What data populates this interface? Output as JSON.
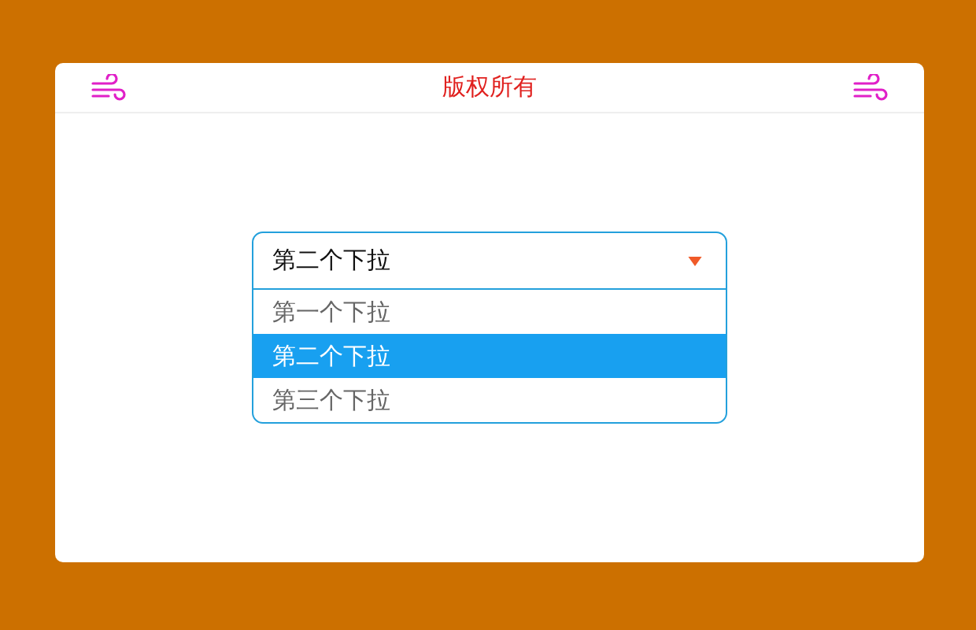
{
  "header": {
    "title": "版权所有"
  },
  "dropdown": {
    "value": "第二个下拉",
    "expanded": true,
    "options": [
      {
        "label": "第一个下拉",
        "selected": false
      },
      {
        "label": "第二个下拉",
        "selected": true
      },
      {
        "label": "第三个下拉",
        "selected": false
      }
    ]
  }
}
